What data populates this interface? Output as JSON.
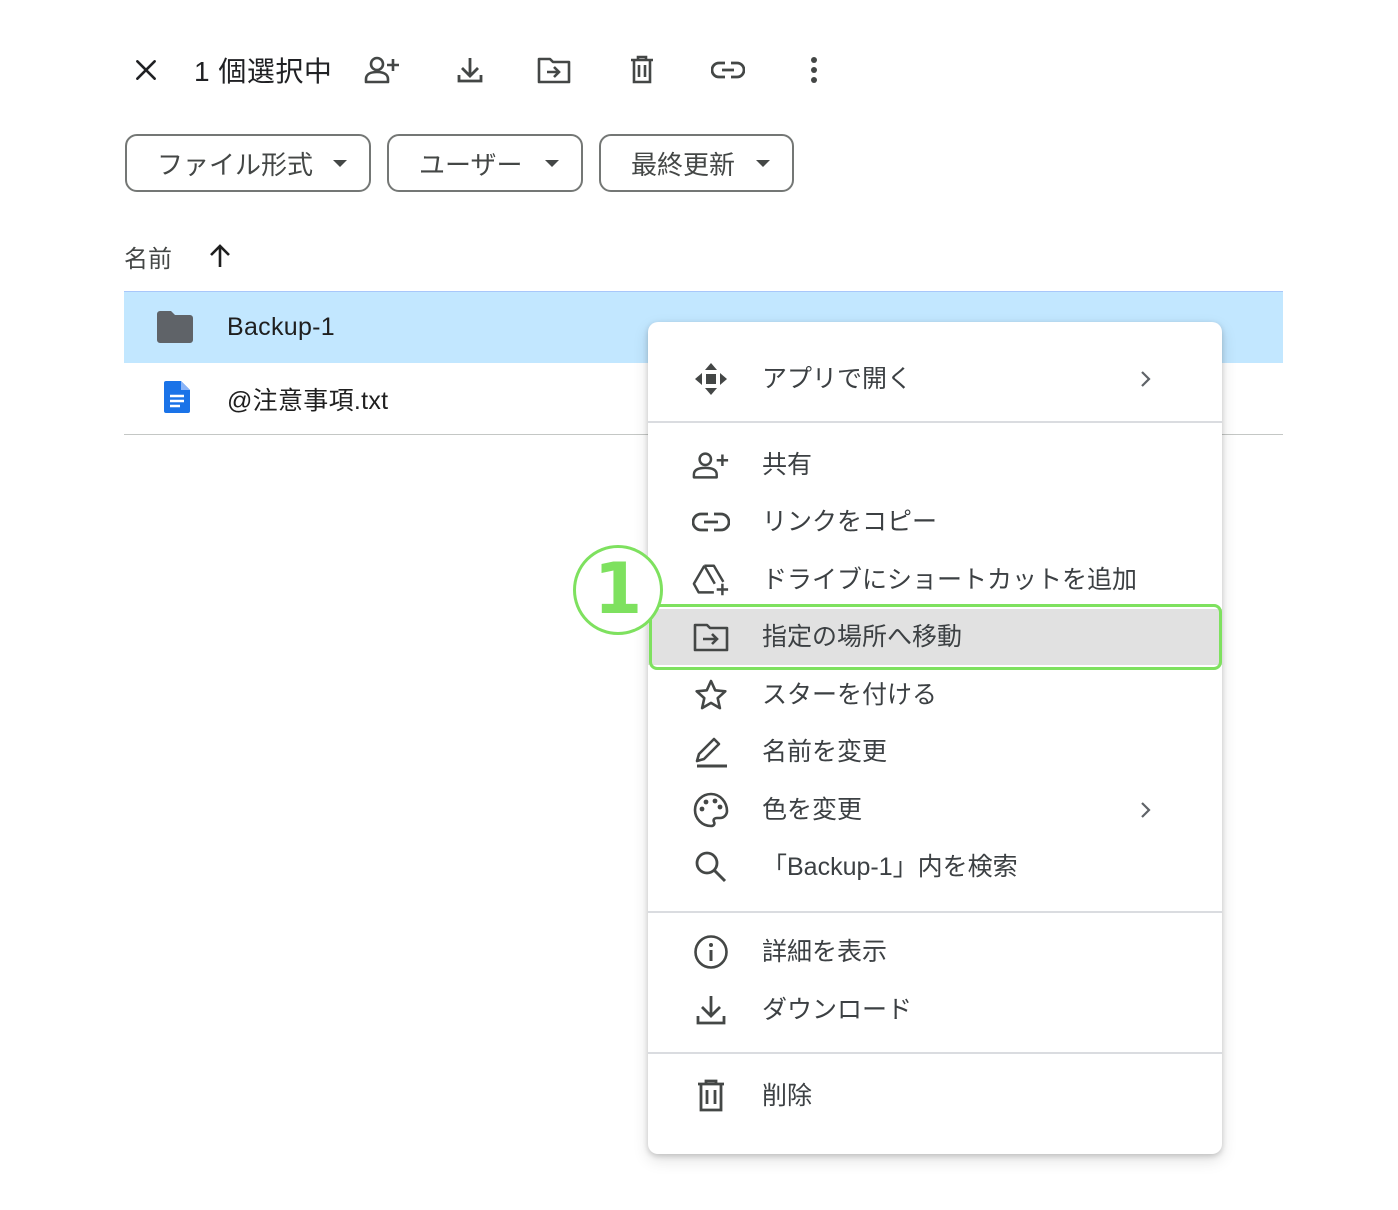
{
  "selection_bar": {
    "count_label": "1 個選択中",
    "actions": [
      "close-icon",
      "share-icon",
      "download-icon",
      "move-icon",
      "trash-icon",
      "link-icon",
      "more-vert-icon"
    ]
  },
  "filters": {
    "file_type": "ファイル形式",
    "people": "ユーザー",
    "modified": "最終更新"
  },
  "list": {
    "sort_label": "名前",
    "sort_direction": "ascending",
    "files": [
      {
        "name": "Backup-1",
        "icon": "folder-icon",
        "selected": true
      },
      {
        "name": "@注意事項.txt",
        "icon": "doc-icon",
        "selected": false
      }
    ]
  },
  "context_menu": {
    "open_with": "アプリで開く",
    "share": "共有",
    "copy_link": "リンクをコピー",
    "add_shortcut": "ドライブにショートカットを追加",
    "move_to": "指定の場所へ移動",
    "add_star": "スターを付ける",
    "rename": "名前を変更",
    "change_color": "色を変更",
    "search_in": "「Backup-1」内を検索",
    "details": "詳細を表示",
    "download": "ダウンロード",
    "delete": "削除",
    "highlighted_item": "move_to"
  },
  "annotation": {
    "step_number": "1",
    "color": "#7ee15f"
  },
  "colors": {
    "selected_row": "#c2e7ff",
    "doc_blue": "#1a73e8",
    "icon_gray": "#444746",
    "menu_highlight": "#e1e1e1"
  }
}
